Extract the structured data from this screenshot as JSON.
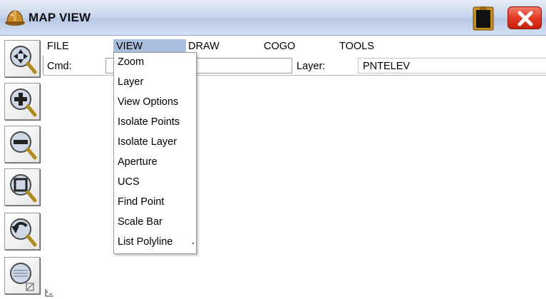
{
  "window": {
    "title": "MAP VIEW",
    "app_icon": "hardhat-icon",
    "clipboard_icon": "clipboard-icon",
    "close_icon": "close-icon"
  },
  "colors": {
    "titlebar_gradient": "#c9d6ec",
    "menu_highlight": "#a9bede",
    "close_button": "#e23a24"
  },
  "toolbar": {
    "buttons": [
      {
        "name": "pan",
        "icon": "pan-magnifier-icon"
      },
      {
        "name": "zoom-in",
        "icon": "zoom-in-icon"
      },
      {
        "name": "zoom-out",
        "icon": "zoom-out-icon"
      },
      {
        "name": "zoom-window",
        "icon": "zoom-window-icon"
      },
      {
        "name": "zoom-previous",
        "icon": "zoom-previous-icon"
      },
      {
        "name": "zoom-extents",
        "icon": "zoom-extents-icon"
      }
    ]
  },
  "menubar": {
    "items": [
      "FILE",
      "VIEW",
      "DRAW",
      "COGO",
      "TOOLS"
    ],
    "active": "VIEW"
  },
  "cmd": {
    "label": "Cmd:",
    "value": ""
  },
  "layer": {
    "label": "Layer:",
    "value": "PNTELEV"
  },
  "view_menu": {
    "items": [
      "Zoom",
      "Layer",
      "View Options",
      "Isolate Points",
      "Isolate Layer",
      "Aperture",
      "UCS",
      "Find Point",
      "Scale Bar",
      "List Polyline"
    ]
  },
  "map": {
    "axis_icon": "ucs-axis-icon"
  }
}
